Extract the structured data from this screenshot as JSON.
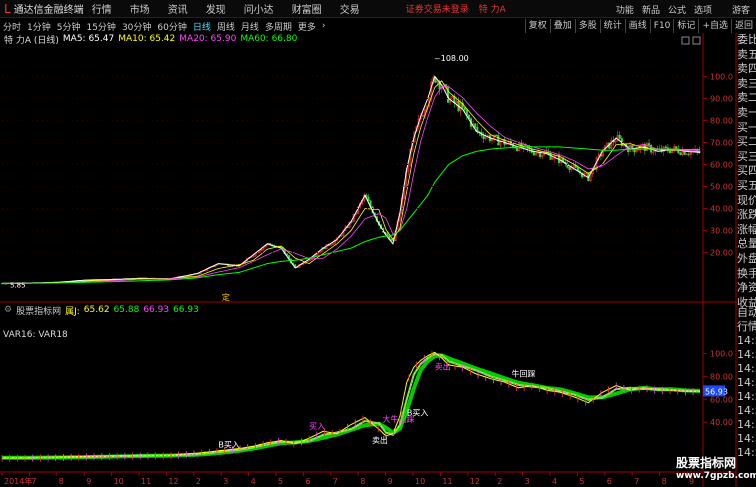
{
  "topbar": {
    "logo": "L",
    "app_title": "通达信金融终端",
    "menus": [
      "行情",
      "市场",
      "资讯",
      "发现",
      "问小达",
      "财富圈",
      "交易"
    ],
    "login_status": "证券交易未登录",
    "stock_name": "特 力A",
    "right_menus": [
      "功能",
      "新品",
      "公式",
      "选项"
    ],
    "user": "游客"
  },
  "toolbar": {
    "periods": [
      "分时",
      "1分钟",
      "5分钟",
      "15分钟",
      "30分钟",
      "60分钟",
      "日线",
      "周线",
      "月线",
      "多周期",
      "更多"
    ],
    "active_period": "日线",
    "tools": [
      "复权",
      "叠加",
      "多股",
      "统计",
      "画线",
      "F10",
      "标记",
      "+自选",
      "返回"
    ]
  },
  "main_chart": {
    "title": "特 力A (日线)",
    "ma5": "MA5: 65.47",
    "ma10": "MA10: 65.42",
    "ma20": "MA20: 65.90",
    "ma60": "MA60: 66.80",
    "high_label": "108.00",
    "low_label": "5.85",
    "marker": "定",
    "y_ticks": [
      "100.0",
      "90.00",
      "80.00",
      "70.00",
      "60.00",
      "50.00",
      "40.00",
      "30.00",
      "20.00"
    ]
  },
  "indicator": {
    "source_icon": "chart-icon",
    "name": "股票指标网",
    "value_label": "属J:",
    "v1": "65.62",
    "v2": "65.88",
    "v3": "66.93",
    "v4": "66.93",
    "var_label": "VAR16: VAR18",
    "current_value": "56.93",
    "y_ticks": [
      "100.0",
      "80.00",
      "60.00",
      "40.00"
    ],
    "signals": [
      "B买入",
      "买入",
      "卖出",
      "大牛回踩",
      "B买入",
      "卖出",
      "牛回踩"
    ]
  },
  "x_axis": [
    "2014年",
    "7",
    "8",
    "9",
    "10",
    "11",
    "12",
    "2",
    "3",
    "4",
    "5",
    "6",
    "7",
    "8",
    "9",
    "10",
    "11",
    "12",
    "2",
    "3",
    "4",
    "5",
    "6",
    "7",
    "8",
    "9"
  ],
  "right_panel": [
    "委比",
    "卖五",
    "卖四",
    "卖三",
    "卖二",
    "卖一",
    "买一",
    "买二",
    "买三",
    "买四",
    "买五",
    "现价",
    "涨跌",
    "涨幅",
    "总量",
    "外盘",
    "换手",
    "净资",
    "收益"
  ],
  "right_panel2": [
    "自动",
    "行情",
    "14:50",
    "14:50",
    "14:50",
    "14:50",
    "14:50",
    "14:50",
    "14:50",
    "14:50",
    "14:50"
  ],
  "watermark": {
    "line1": "股票指标网",
    "line2": "www.7gpzb.com"
  },
  "colors": {
    "background": "#000000",
    "ma5": "#ffffff",
    "ma10": "#ffff00",
    "ma20": "#ff44ff",
    "ma60": "#00ff00",
    "up": "#ff3333",
    "down": "#33dd33",
    "axis": "#a00000"
  },
  "chart_data": {
    "type": "line",
    "title": "特 力A (日线)",
    "x": [
      0,
      4,
      8,
      12,
      16,
      20,
      24,
      28,
      31,
      34,
      36,
      38,
      40,
      42,
      44,
      46,
      48,
      50,
      52,
      54,
      55,
      56,
      57,
      58,
      59,
      60,
      61,
      62,
      63,
      64,
      66,
      68,
      70,
      72,
      74,
      76,
      78,
      80,
      82,
      84,
      86,
      88,
      90,
      92,
      94,
      96,
      98,
      100
    ],
    "series": [
      {
        "name": "close",
        "values": [
          6.0,
          6.2,
          6.5,
          7.5,
          7.8,
          8.3,
          8.0,
          10.5,
          15.0,
          14.0,
          19.0,
          24.0,
          22.0,
          13.0,
          17.0,
          22.0,
          26.0,
          34.0,
          46.0,
          33.0,
          28.0,
          24.0,
          38.0,
          58.0,
          72.0,
          82.0,
          90.0,
          100.0,
          96.0,
          90.0,
          85.0,
          75.0,
          72.0,
          70.0,
          68.0,
          66.0,
          65.0,
          62.0,
          58.0,
          54.0,
          66.0,
          72.0,
          67.0,
          68.0,
          66.0,
          67.0,
          66.0,
          65.5
        ]
      },
      {
        "name": "MA60",
        "values": [
          6.0,
          6.1,
          6.2,
          6.5,
          6.8,
          7.2,
          7.6,
          8.5,
          10.0,
          11.0,
          13.0,
          15.0,
          16.0,
          16.5,
          17.5,
          19.0,
          20.5,
          22.0,
          25.0,
          27.0,
          27.5,
          28.0,
          30.0,
          34.0,
          38.0,
          42.0,
          46.0,
          52.0,
          56.0,
          60.0,
          64.0,
          66.0,
          67.0,
          67.5,
          68.0,
          68.0,
          68.0,
          68.0,
          67.5,
          67.0,
          66.5,
          66.5,
          67.0,
          67.0,
          67.0,
          66.9,
          66.8,
          66.8
        ]
      }
    ],
    "ylim": [
      3,
      112
    ],
    "indicator_series": {
      "name": "VAR16",
      "values": [
        9,
        9,
        9.5,
        10,
        10.5,
        11,
        11,
        13,
        15,
        17,
        19,
        22,
        24,
        21,
        26,
        32,
        30,
        38,
        44,
        34,
        28,
        30,
        45,
        75,
        88,
        94,
        98,
        101,
        96,
        90,
        88,
        82,
        78,
        75,
        70,
        72,
        68,
        66,
        62,
        57,
        66,
        72,
        68,
        70,
        68,
        68,
        67,
        66.9
      ],
      "ylim": [
        0,
        110
      ]
    }
  }
}
